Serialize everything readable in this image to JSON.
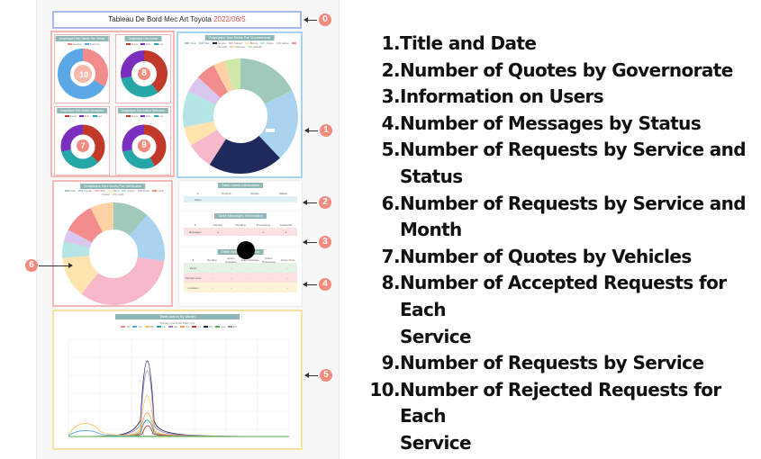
{
  "dashboard": {
    "title": "Tableau De Bord Mec Art Toyota",
    "date": "2022/06/5",
    "panels": {
      "clients": {
        "title": "Graphique Des Clients Par Genre",
        "badge": "10"
      },
      "active": {
        "title": "Graphique Des Active",
        "badge": "8"
      },
      "governorate": {
        "title": "Graphique Des Devis Par Gouvernorat"
      },
      "accepted": {
        "title": "Graphique Des Action Acceptes",
        "badge": "7"
      },
      "refused": {
        "title": "Graphique Des Action Refusees",
        "badge": "9"
      },
      "vehicles": {
        "title": "Graphique Des Devis Par Vehicules"
      },
      "users_table": {
        "title": "Table Users Information",
        "headers": [
          "#",
          "Nombre",
          "Societe",
          "Salarie"
        ],
        "rows": [
          [
            "Users",
            "-",
            "-",
            "-"
          ]
        ]
      },
      "messages_table": {
        "title": "Table Messages Information",
        "headers": [
          "#",
          "Nombre",
          "Pending",
          "Processing",
          "Answered"
        ],
        "rows": [
          [
            "Messages",
            "4",
            "-",
            "1",
            "3"
          ]
        ]
      },
      "actions_table": {
        "title": "Table Action Information",
        "headers": [
          "#",
          "Nombre",
          "Action Acceptee",
          "Action Refusee",
          "Action Processing",
          "Action Time"
        ],
        "rows": [
          [
            "Devis",
            "-",
            "-",
            "-",
            "-",
            "-"
          ],
          [
            "Rendez-vous",
            "-",
            "-",
            "-",
            "-",
            "-"
          ],
          [
            "Livraison",
            "-",
            "-",
            "-",
            "-",
            "-"
          ]
        ]
      },
      "month_chart": {
        "title": "Table Action By Month",
        "subtitle": "Display Line Chart Math Line"
      }
    },
    "callouts": [
      "0",
      "1",
      "2",
      "3",
      "4",
      "5",
      "6"
    ]
  },
  "legend_list": [
    {
      "n": "1.",
      "text": "Title and Date"
    },
    {
      "n": "2.",
      "text": "Number of Quotes by Governorate"
    },
    {
      "n": "3.",
      "text": "Information on Users"
    },
    {
      "n": "4.",
      "text": "Number of Messages by Status"
    },
    {
      "n": "5.",
      "text": "Number of Requests by Service and"
    },
    {
      "n": "",
      "text": "Status"
    },
    {
      "n": "6.",
      "text": "Number of Requests by Service and"
    },
    {
      "n": "",
      "text": "Month"
    },
    {
      "n": "7.",
      "text": "Number of Quotes by Vehicles"
    },
    {
      "n": "8.",
      "text": "Number of Accepted Requests for Each"
    },
    {
      "n": "",
      "text": "Service"
    },
    {
      "n": "9.",
      "text": "Number of Requests by Service"
    },
    {
      "n": "10.",
      "text": "Number of Rejected Requests for Each"
    },
    {
      "n": "",
      "text": "Service"
    }
  ],
  "colors": {
    "title_border": "#a9b8f0",
    "pink_border": "#f3b8b8",
    "blue_border": "#a9d3ee",
    "yellow_border": "#f6e3a0",
    "callout": "#f28b7e",
    "date": "#d9534f"
  }
}
